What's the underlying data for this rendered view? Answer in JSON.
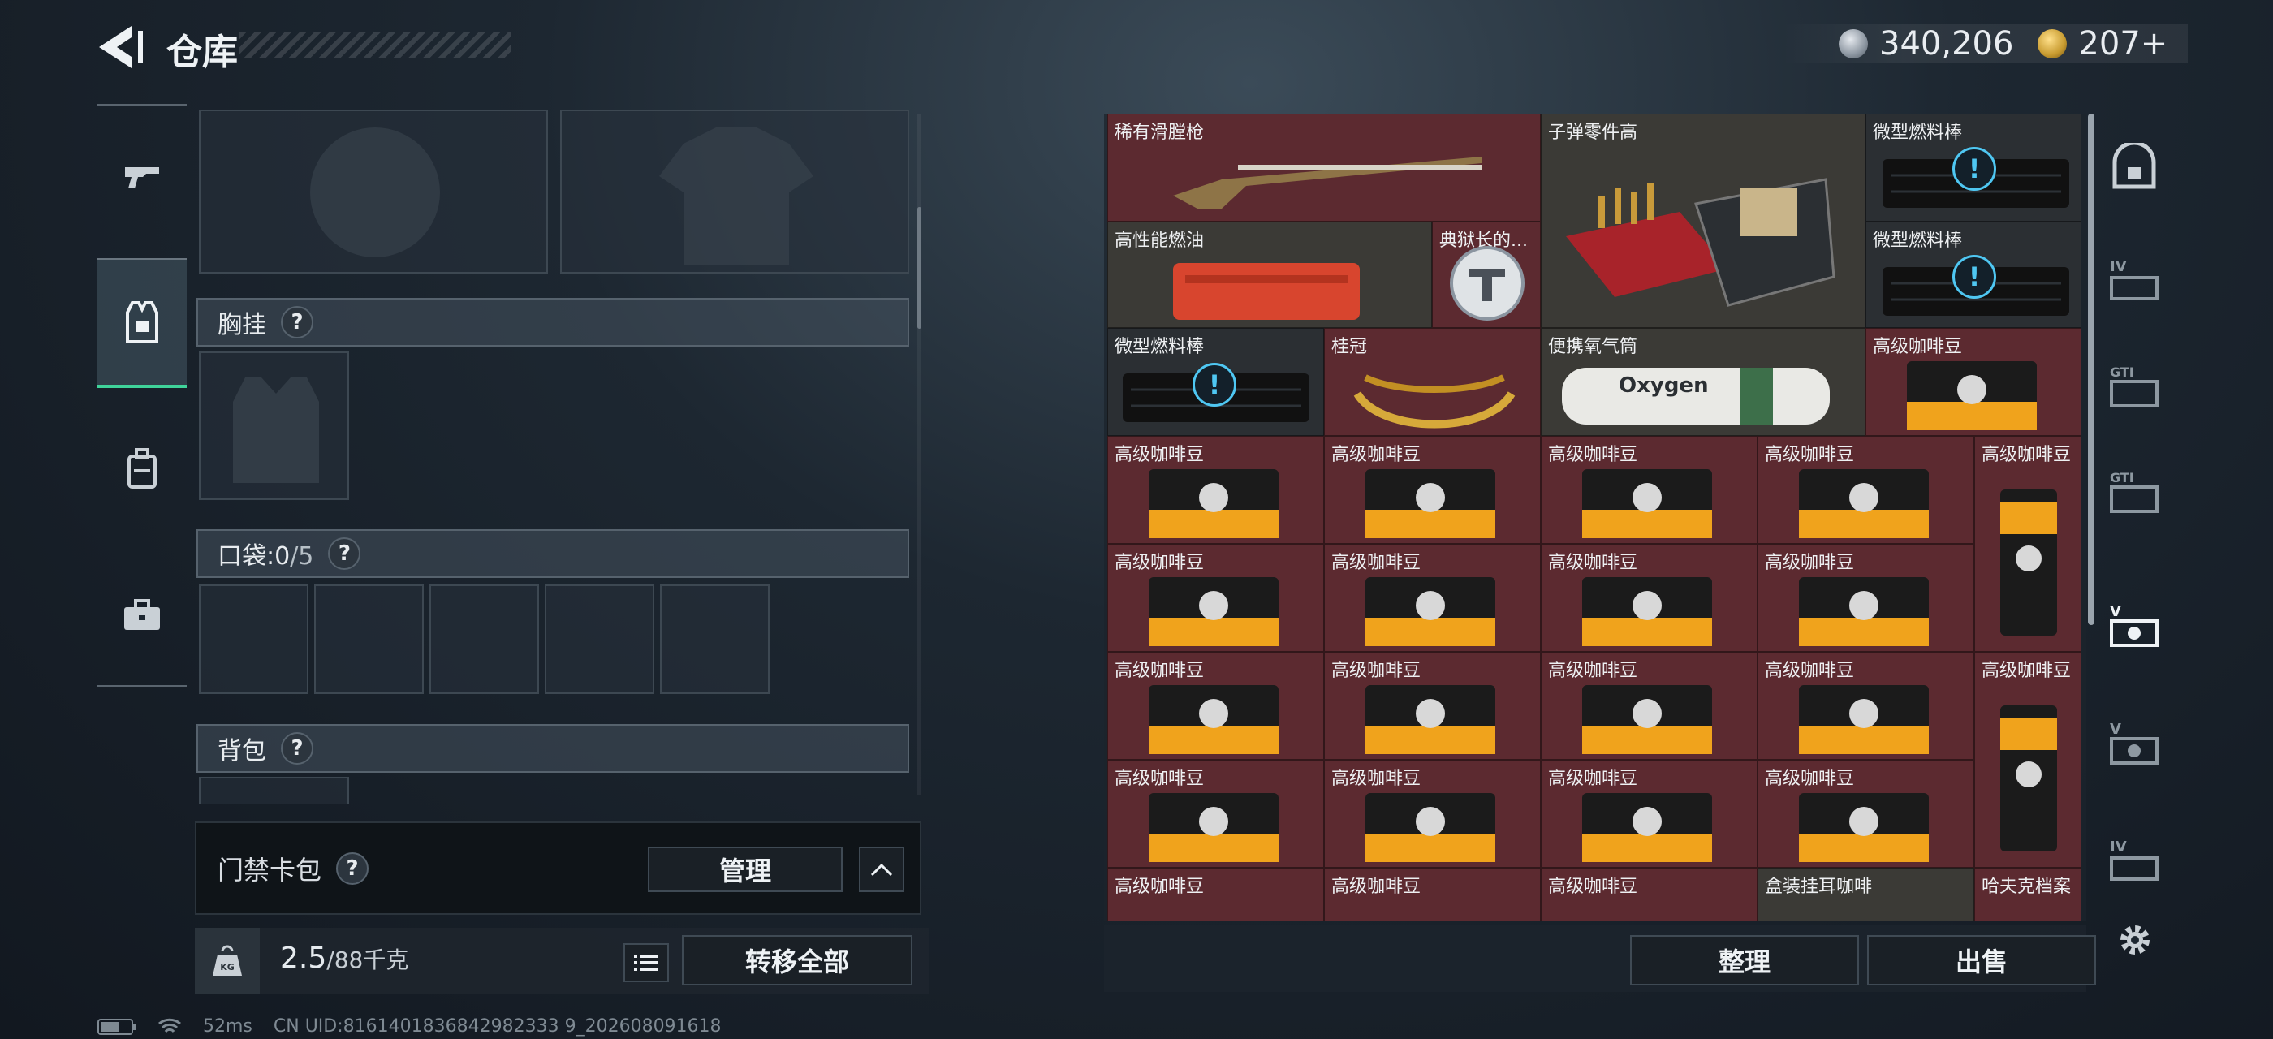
{
  "header": {
    "title": "仓库",
    "currencies": [
      {
        "icon": "silver-coin-icon",
        "value": "340,206"
      },
      {
        "icon": "gold-coin-icon",
        "value": "207+"
      }
    ]
  },
  "left_nav": [
    {
      "name": "weapons",
      "icon": "gun-icon"
    },
    {
      "name": "chest-rig",
      "icon": "vest-icon",
      "active": true
    },
    {
      "name": "backpack",
      "icon": "bag-icon"
    },
    {
      "name": "briefcase",
      "icon": "briefcase-icon"
    }
  ],
  "equipment": {
    "chest_rig_label": "胸挂",
    "pocket_label": "口袋:",
    "pocket_current": "0",
    "pocket_total": "/5",
    "backpack_label": "背包",
    "help_glyph": "?"
  },
  "card_pack": {
    "label": "门禁卡包",
    "manage_button": "管理"
  },
  "weight": {
    "current": "2.5",
    "max": "/88千克",
    "kg_badge": "KG"
  },
  "transfer_all_button": "转移全部",
  "storage": {
    "items": [
      {
        "label": "稀有滑膛枪",
        "type": "rifle"
      },
      {
        "label": "子弹零件高",
        "type": "ammo-box"
      },
      {
        "label": "微型燃料棒",
        "type": "fuel-rod",
        "warn": true
      },
      {
        "label": "高性能燃油",
        "type": "fuel-case"
      },
      {
        "label": "典狱长的...",
        "type": "badge"
      },
      {
        "label": "微型燃料棒",
        "type": "fuel-rod",
        "warn": true
      },
      {
        "label": "微型燃料棒",
        "type": "fuel-rod",
        "warn": true
      },
      {
        "label": "桂冠",
        "type": "laurel"
      },
      {
        "label": "便携氧气筒",
        "type": "oxygen"
      },
      {
        "label": "高级咖啡豆",
        "type": "coffee"
      },
      {
        "label": "高级咖啡豆",
        "type": "coffee-tall"
      },
      {
        "label": "盒装挂耳咖啡",
        "type": "coffee-box"
      },
      {
        "label": "哈夫克档案",
        "type": "file"
      }
    ],
    "oxygen_text": "Oxygen",
    "warn_glyph": "!",
    "sort_button": "整理",
    "sell_button": "出售"
  },
  "right_nav": [
    {
      "name": "safe-box",
      "icon": "safe-icon"
    },
    {
      "name": "tier-IV",
      "icon": "tier-IV-icon",
      "text": "IV"
    },
    {
      "name": "tier-GTI-1",
      "icon": "tier-GTI-icon",
      "text": "GTI"
    },
    {
      "name": "tier-GTI-2",
      "icon": "tier-GTI-icon",
      "text": "GTI"
    },
    {
      "name": "tier-V-1",
      "icon": "tier-V-icon",
      "text": "V",
      "active": true
    },
    {
      "name": "tier-V-2",
      "icon": "tier-V-icon",
      "text": "V"
    },
    {
      "name": "tier-IV-2",
      "icon": "tier-IV-icon",
      "text": "IV"
    },
    {
      "name": "settings",
      "icon": "gear-icon"
    }
  ],
  "status_bar": {
    "ping": "52ms",
    "uid": "CN UID:8161401836842982333 9_202608091618"
  }
}
